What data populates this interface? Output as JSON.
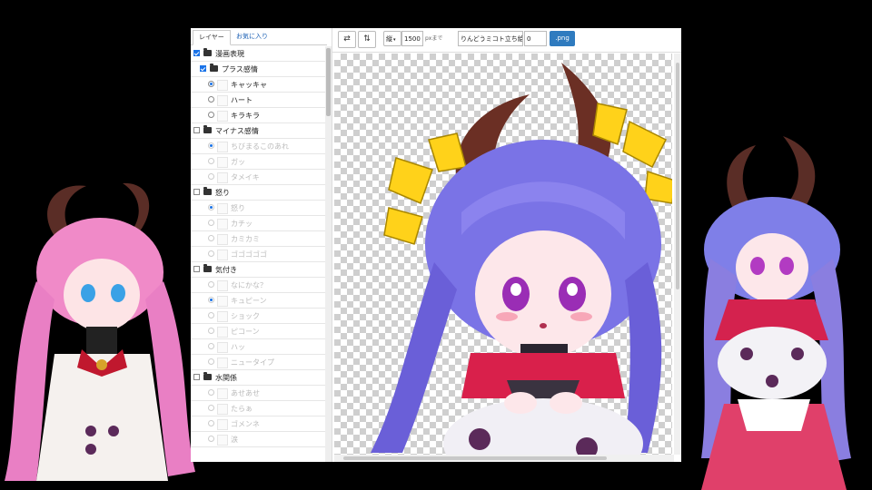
{
  "tabs": [
    {
      "label": "レイヤー",
      "active": true
    },
    {
      "label": "お気に入り",
      "active": false
    }
  ],
  "layers": [
    {
      "type": "folder",
      "label": "漫画表現",
      "checked": true,
      "level": 0,
      "dim": false
    },
    {
      "type": "folder",
      "label": "プラス感情",
      "checked": true,
      "level": 1,
      "dim": false
    },
    {
      "type": "item",
      "label": "キャッキャ",
      "selected": true,
      "dim": false
    },
    {
      "type": "item",
      "label": "ハート",
      "selected": false,
      "dim": false
    },
    {
      "type": "item",
      "label": "キラキラ",
      "selected": false,
      "dim": false
    },
    {
      "type": "folder",
      "label": "マイナス感情",
      "checked": false,
      "level": 0,
      "dim": false
    },
    {
      "type": "item",
      "label": "ちびまるこのあれ",
      "selected": true,
      "dim": true
    },
    {
      "type": "item",
      "label": "ガッ",
      "selected": false,
      "dim": true
    },
    {
      "type": "item",
      "label": "タメイキ",
      "selected": false,
      "dim": true
    },
    {
      "type": "folder",
      "label": "怒り",
      "checked": false,
      "level": 0,
      "dim": false
    },
    {
      "type": "item",
      "label": "怒り",
      "selected": true,
      "dim": true
    },
    {
      "type": "item",
      "label": "カチッ",
      "selected": false,
      "dim": true
    },
    {
      "type": "item",
      "label": "カミカミ",
      "selected": false,
      "dim": true
    },
    {
      "type": "item",
      "label": "ゴゴゴゴゴ",
      "selected": false,
      "dim": true
    },
    {
      "type": "folder",
      "label": "気付き",
      "checked": false,
      "level": 0,
      "dim": false
    },
    {
      "type": "item",
      "label": "なにかな？",
      "selected": false,
      "dim": true
    },
    {
      "type": "item",
      "label": "キュピーン",
      "selected": true,
      "dim": true
    },
    {
      "type": "item",
      "label": "ショック",
      "selected": false,
      "dim": true
    },
    {
      "type": "item",
      "label": "ピコーン",
      "selected": false,
      "dim": true
    },
    {
      "type": "item",
      "label": "ハッ",
      "selected": false,
      "dim": true
    },
    {
      "type": "item",
      "label": "ニュータイプ",
      "selected": false,
      "dim": true
    },
    {
      "type": "folder",
      "label": "水関係",
      "checked": false,
      "level": 0,
      "dim": false
    },
    {
      "type": "item",
      "label": "あせあせ",
      "selected": false,
      "dim": true
    },
    {
      "type": "item",
      "label": "たらぁ",
      "selected": false,
      "dim": true
    },
    {
      "type": "item",
      "label": "ゴメンネ",
      "selected": false,
      "dim": true
    },
    {
      "type": "item",
      "label": "涙",
      "selected": false,
      "dim": true
    }
  ],
  "toolbar": {
    "swap_icon": "⇄",
    "sort_icon": "⇅",
    "orientation": "縦",
    "size_value": "1500",
    "size_suffix": "pxまで",
    "filename_value": "りんどうミコト立ち絵",
    "number_value": "0",
    "export_label": ".png"
  },
  "colors": {
    "accent": "#2f7bbf",
    "checkbox": "#1a73e8"
  }
}
